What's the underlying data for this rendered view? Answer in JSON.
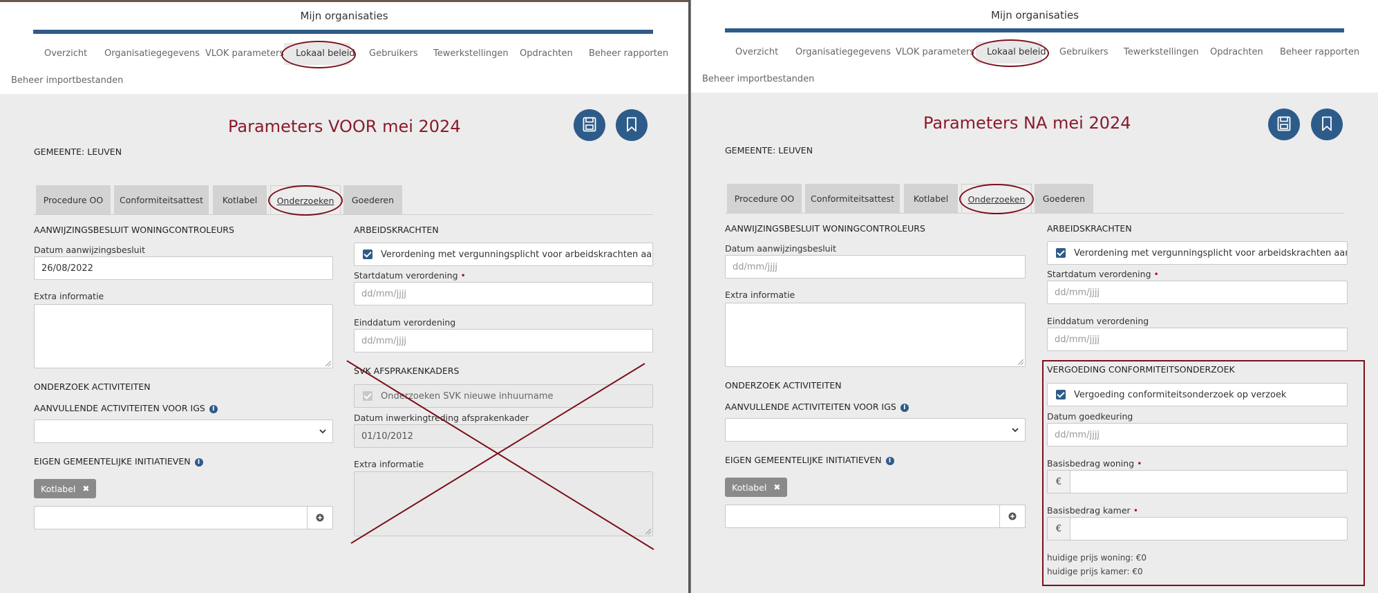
{
  "colors": {
    "brand_blue": "#2e5c8a",
    "annotation_red": "#7a0f1a",
    "heading_red": "#8b1a2b",
    "panel_bg": "#ececec"
  },
  "left": {
    "org_title": "Mijn organisaties",
    "nav": [
      "Overzicht",
      "Organisatiegegevens",
      "VLOK parameters",
      "Lokaal beleid",
      "Gebruikers",
      "Tewerkstellingen",
      "Opdrachten",
      "Beheer rapporten"
    ],
    "import_link": "Beheer importbestanden",
    "heading": "Parameters VOOR mei 2024",
    "gemeente": "GEMEENTE: LEUVEN",
    "tabs": [
      "Procedure OO",
      "Conformiteitsattest",
      "Kotlabel",
      "Onderzoeken",
      "Goederen"
    ],
    "sec_aanwijzing": "AANWIJZINGSBESLUIT WONINGCONTROLEURS",
    "lbl_datum_aanw": "Datum aanwijzingsbesluit",
    "val_datum_aanw": "26/08/2022",
    "lbl_extra": "Extra informatie",
    "sec_onderzoek": "ONDERZOEK ACTIVITEITEN",
    "sec_aanvullend": "AANVULLENDE ACTIVITEITEN VOOR IGS",
    "sec_eigen": "EIGEN GEMEENTELIJKE INITIATIEVEN",
    "tag": "Kotlabel",
    "sec_arbeid": "ARBEIDSKRACHTEN",
    "chk_verordening": "Verordening met vergunningsplicht voor arbeidskrachten aanwezig",
    "lbl_startdatum": "Startdatum verordening",
    "ph_date": "dd/mm/jjjj",
    "lbl_einddatum": "Einddatum verordening",
    "sec_svk": "SVK AFSPRAKENKADERS",
    "chk_svk": "Onderzoeken SVK nieuwe inhuurname",
    "lbl_inwerking": "Datum inwerkingtreding afsprakenkader",
    "val_inwerking": "01/10/2012",
    "lbl_extra2": "Extra informatie"
  },
  "right": {
    "org_title": "Mijn organisaties",
    "nav": [
      "Overzicht",
      "Organisatiegegevens",
      "VLOK parameters",
      "Lokaal beleid",
      "Gebruikers",
      "Tewerkstellingen",
      "Opdrachten",
      "Beheer rapporten"
    ],
    "import_link": "Beheer importbestanden",
    "heading": "Parameters NA mei 2024",
    "gemeente": "GEMEENTE: LEUVEN",
    "tabs": [
      "Procedure OO",
      "Conformiteitsattest",
      "Kotlabel",
      "Onderzoeken",
      "Goederen"
    ],
    "sec_aanwijzing": "AANWIJZINGSBESLUIT WONINGCONTROLEURS",
    "lbl_datum_aanw": "Datum aanwijzingsbesluit",
    "lbl_extra": "Extra informatie",
    "sec_onderzoek": "ONDERZOEK ACTIVITEITEN",
    "sec_aanvullend": "AANVULLENDE ACTIVITEITEN VOOR IGS",
    "sec_eigen": "EIGEN GEMEENTELIJKE INITIATIEVEN",
    "tag": "Kotlabel",
    "sec_arbeid": "ARBEIDSKRACHTEN",
    "chk_verordening": "Verordening met vergunningsplicht voor arbeidskrachten aanwezig",
    "lbl_startdatum": "Startdatum verordening",
    "ph_date": "dd/mm/jjjj",
    "lbl_einddatum": "Einddatum verordening",
    "sec_vergoeding": "VERGOEDING CONFORMITEITSONDERZOEK",
    "chk_vergoeding": "Vergoeding conformiteitsonderzoek op verzoek",
    "lbl_goedkeuring": "Datum goedkeuring",
    "lbl_basis_woning": "Basisbedrag woning",
    "lbl_basis_kamer": "Basisbedrag kamer",
    "euro": "€",
    "hint_woning": "huidige prijs woning: €0",
    "hint_kamer": "huidige prijs kamer: €0"
  }
}
